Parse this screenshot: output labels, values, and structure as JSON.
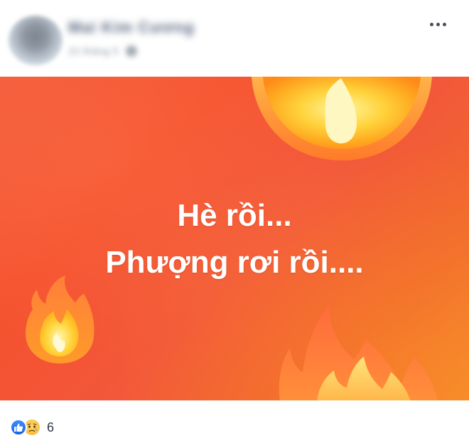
{
  "header": {
    "author_name": "Mai Kim Cương",
    "timestamp": "22 tháng 5",
    "privacy_icon": "globe-icon",
    "more_icon": "more-horizontal-icon"
  },
  "image": {
    "line_1": "Hè rồi...",
    "line_2": "Phượng rơi rồi....",
    "background_colors": [
      "#f45a3a",
      "#f06a2c",
      "#f58a2b"
    ],
    "decorations": [
      "fire-emoji",
      "fire-emoji",
      "fire-emoji"
    ]
  },
  "reactions": {
    "icons": [
      "like-icon",
      "sad-icon"
    ],
    "count": "6",
    "like_color": "#1877f2",
    "sad_color": "#f7b93c"
  }
}
